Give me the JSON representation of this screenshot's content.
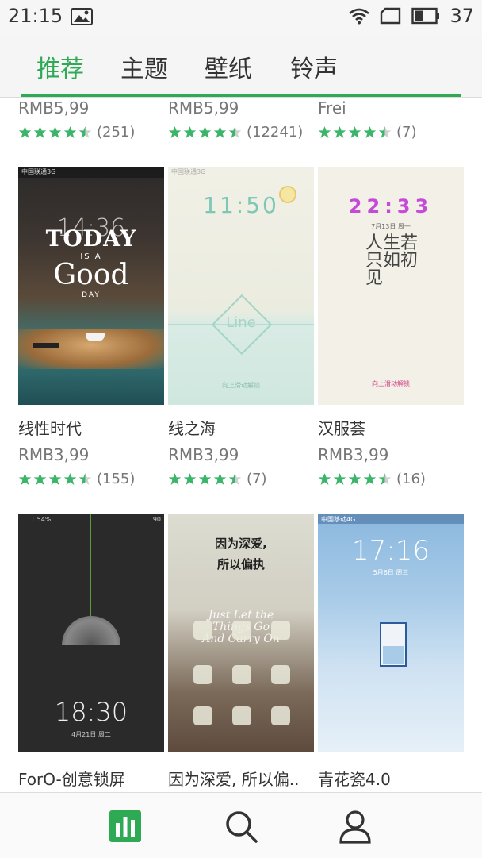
{
  "status": {
    "time": "21:15",
    "battery": "37"
  },
  "tabs": [
    "推荐",
    "主题",
    "壁纸",
    "铃声"
  ],
  "top_row": [
    {
      "price": "RMB5,99",
      "count": "(251)"
    },
    {
      "price": "RMB5,99",
      "count": "(12241)"
    },
    {
      "price": "Frei",
      "count": "(7)"
    }
  ],
  "row2": [
    {
      "name": "线性时代",
      "price": "RMB3,99",
      "count": "(155)",
      "thumb": {
        "status": "中国联通3G",
        "big1": "14:36",
        "big2": "TODAY",
        "big3": "IS A",
        "big4": "Good",
        "big5": "DAY"
      }
    },
    {
      "name": "线之海",
      "price": "RMB3,99",
      "count": "(7)",
      "thumb": {
        "status": "中国联通3G",
        "clock": "11:50",
        "label": "Line",
        "hint": "向上滑动解锁"
      }
    },
    {
      "name": "汉服荟",
      "price": "RMB3,99",
      "count": "(16)",
      "thumb": {
        "clock": "22:33",
        "date": "7月13日  周一",
        "poem": "人生若只如初见",
        "hint": "向上滑动解锁"
      }
    }
  ],
  "row3": [
    {
      "name": "ForO-创意锁屏",
      "thumb": {
        "status": "1.54%",
        "signal": "90",
        "clock": "18:30",
        "date": "4月21日  周二"
      }
    },
    {
      "name": "因为深爱, 所以偏..",
      "thumb": {
        "line1": "因为深爱,",
        "line2": "所以偏执",
        "script": "Just Let the Things Go And Carry On"
      }
    },
    {
      "name": "青花瓷4.0",
      "thumb": {
        "status": "中国移动4G",
        "clock": "17:16",
        "date": "5月6日  周三"
      }
    }
  ],
  "colors": {
    "accent": "#2eaa55",
    "star": "#3cb56a"
  },
  "icons": {
    "chart": "chart-icon",
    "search": "search-icon",
    "user": "user-icon"
  }
}
